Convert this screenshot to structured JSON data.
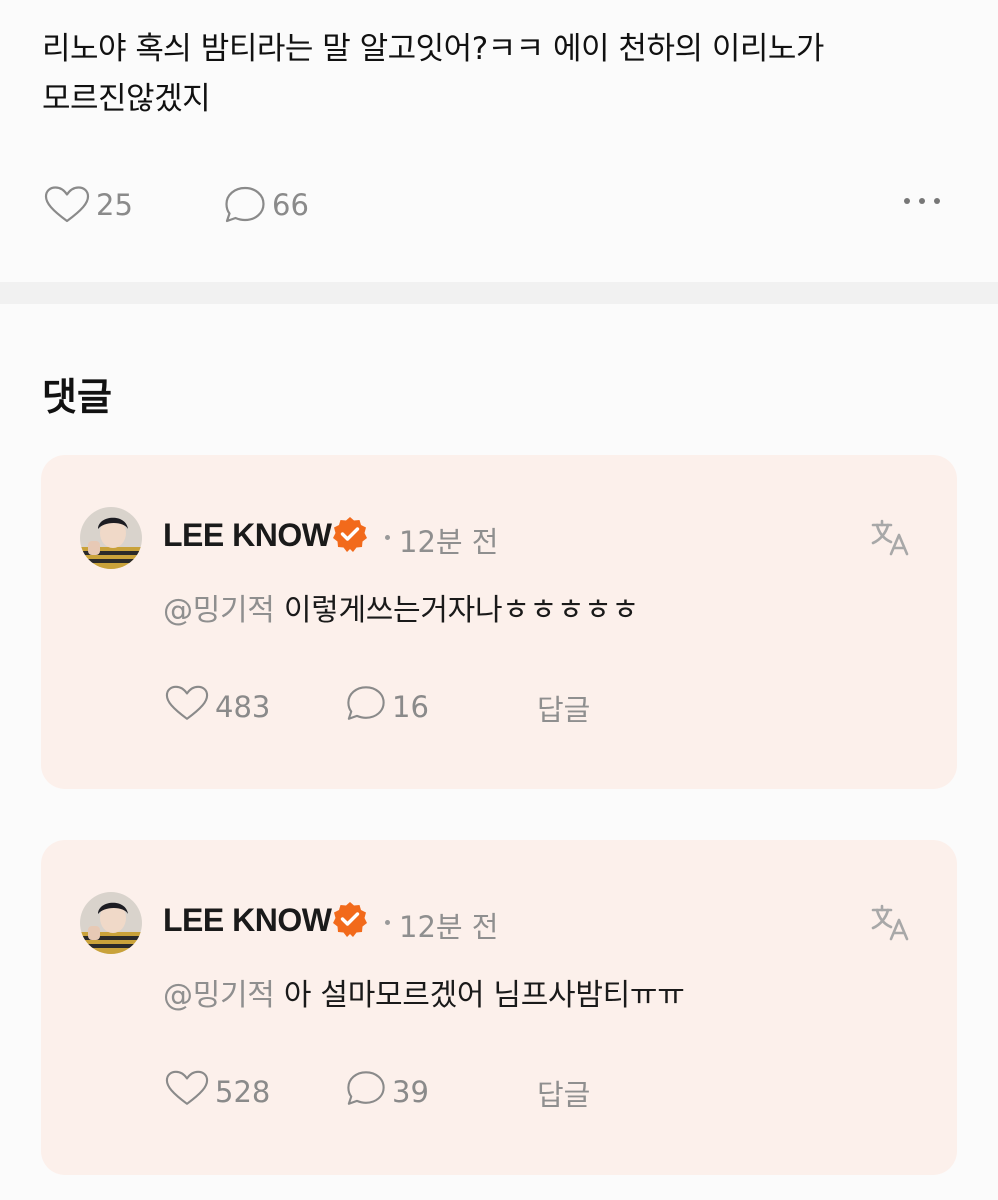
{
  "post": {
    "text": "리노야 혹싀 밤티라는 말 알고잇어?ㅋㅋ 에이 천하의 이리노가\n모르진않겠지",
    "like_count": "25",
    "comment_count": "66"
  },
  "comments_section": {
    "title": "댓글"
  },
  "comments": [
    {
      "author": "LEE KNOW",
      "time": "12분 전",
      "mention": "@밍기적",
      "text": "이렇게쓰는거자나ㅎㅎㅎㅎㅎ",
      "like_count": "483",
      "reply_count": "16",
      "reply_label": "답글"
    },
    {
      "author": "LEE KNOW",
      "time": "12분 전",
      "mention": "@밍기적",
      "text": "아 설마모르겠어 님프사밤티ㅠㅠ",
      "like_count": "528",
      "reply_count": "39",
      "reply_label": "답글"
    }
  ],
  "icons": {
    "like": "heart-icon",
    "comment": "speech-bubble-icon",
    "more": "more-dots-icon",
    "verified": "verified-badge-icon",
    "translate": "translate-icon"
  },
  "colors": {
    "badge": "#f26a1b",
    "card_bg": "#fcf0eb",
    "muted_text": "#8f8f8f"
  }
}
